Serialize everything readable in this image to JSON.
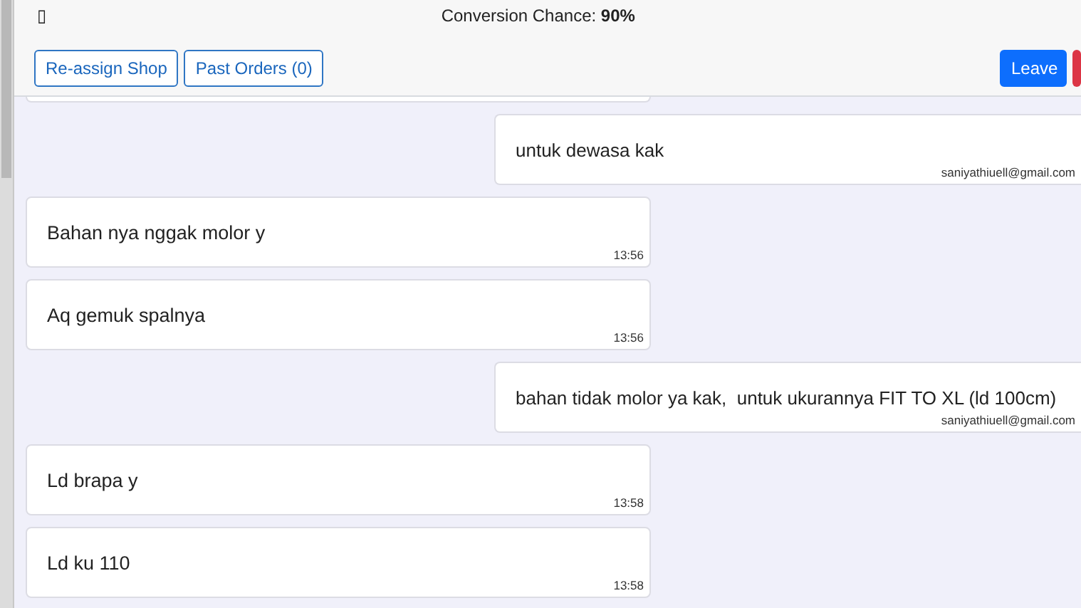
{
  "header": {
    "icon": "▯",
    "title": "Conversion Chance: **90%**",
    "buttons": [
      {
        "label": "Re-assign Shop",
        "kind": "outline"
      },
      {
        "label": "Past Orders (0)",
        "kind": "outline"
      },
      {
        "label": "Leave",
        "kind": "primary"
      }
    ]
  },
  "messages": [
    {
      "kind": "outgoing",
      "text": "untuk dewasa kak",
      "meta": "saniyathiuell@gmail.com"
    },
    {
      "kind": "incoming",
      "text": "Bahan nya nggak molor y",
      "meta": "13:56"
    },
    {
      "kind": "incoming",
      "text": "Aq gemuk spalnya",
      "meta": "13:56"
    },
    {
      "kind": "outgoing",
      "text": "bahan tidak molor ya kak,  untuk ukurannya FIT TO XL (ld 100cm)",
      "meta": "saniyathiuell@gmail.com"
    },
    {
      "kind": "incoming",
      "text": "Ld brapa y",
      "meta": "13:58"
    },
    {
      "kind": "incoming",
      "text": "Ld ku 110",
      "meta": "13:58"
    }
  ]
}
